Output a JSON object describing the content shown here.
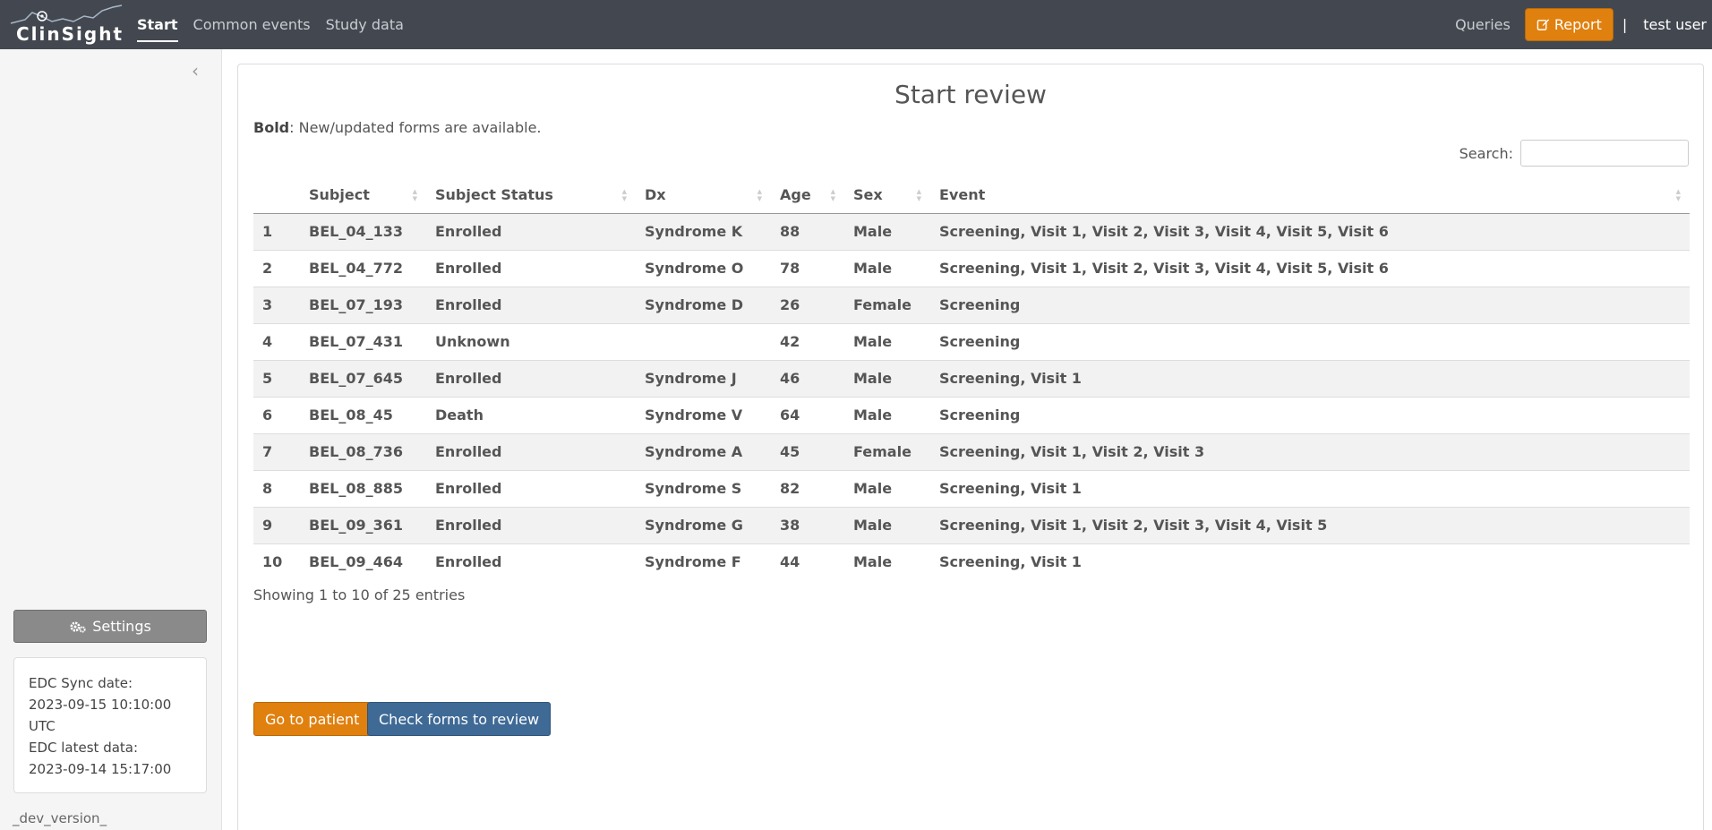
{
  "app": {
    "logo_text": "ClinSight"
  },
  "nav": {
    "items": [
      {
        "label": "Start",
        "active": true
      },
      {
        "label": "Common events",
        "active": false
      },
      {
        "label": "Study data",
        "active": false
      }
    ],
    "queries_label": "Queries",
    "report_label": "Report",
    "separator": "|",
    "user_label": "test user"
  },
  "sidebar": {
    "settings_label": "Settings",
    "sync": {
      "sync_label": "EDC Sync date:",
      "sync_value": "2023-09-15 10:10:00 UTC",
      "latest_label": "EDC latest data:",
      "latest_value": "2023-09-14 15:17:00"
    },
    "version": "_dev_version_"
  },
  "main": {
    "title": "Start review",
    "legend_bold": "Bold",
    "legend_rest": ": New/updated forms are available.",
    "search_label": "Search:",
    "search_value": "",
    "table": {
      "headers": [
        "",
        "Subject",
        "Subject Status",
        "Dx",
        "Age",
        "Sex",
        "Event"
      ],
      "rows": [
        [
          "1",
          "BEL_04_133",
          "Enrolled",
          "Syndrome K",
          "88",
          "Male",
          "Screening, Visit 1, Visit 2, Visit 3, Visit 4, Visit 5, Visit 6"
        ],
        [
          "2",
          "BEL_04_772",
          "Enrolled",
          "Syndrome O",
          "78",
          "Male",
          "Screening, Visit 1, Visit 2, Visit 3, Visit 4, Visit 5, Visit 6"
        ],
        [
          "3",
          "BEL_07_193",
          "Enrolled",
          "Syndrome D",
          "26",
          "Female",
          "Screening"
        ],
        [
          "4",
          "BEL_07_431",
          "Unknown",
          "",
          "42",
          "Male",
          "Screening"
        ],
        [
          "5",
          "BEL_07_645",
          "Enrolled",
          "Syndrome J",
          "46",
          "Male",
          "Screening, Visit 1"
        ],
        [
          "6",
          "BEL_08_45",
          "Death",
          "Syndrome V",
          "64",
          "Male",
          "Screening"
        ],
        [
          "7",
          "BEL_08_736",
          "Enrolled",
          "Syndrome A",
          "45",
          "Female",
          "Screening, Visit 1, Visit 2, Visit 3"
        ],
        [
          "8",
          "BEL_08_885",
          "Enrolled",
          "Syndrome S",
          "82",
          "Male",
          "Screening, Visit 1"
        ],
        [
          "9",
          "BEL_09_361",
          "Enrolled",
          "Syndrome G",
          "38",
          "Male",
          "Screening, Visit 1, Visit 2, Visit 3, Visit 4, Visit 5"
        ],
        [
          "10",
          "BEL_09_464",
          "Enrolled",
          "Syndrome F",
          "44",
          "Male",
          "Screening, Visit 1"
        ]
      ]
    },
    "info": "Showing 1 to 10 of 25 entries",
    "go_to_patient_label": "Go to patient",
    "check_forms_label": "Check forms to review"
  },
  "colors": {
    "navbar": "#434850",
    "accent_orange": "#e0800e",
    "accent_blue": "#3f6a96",
    "settings_gray": "#8a8a8a"
  }
}
